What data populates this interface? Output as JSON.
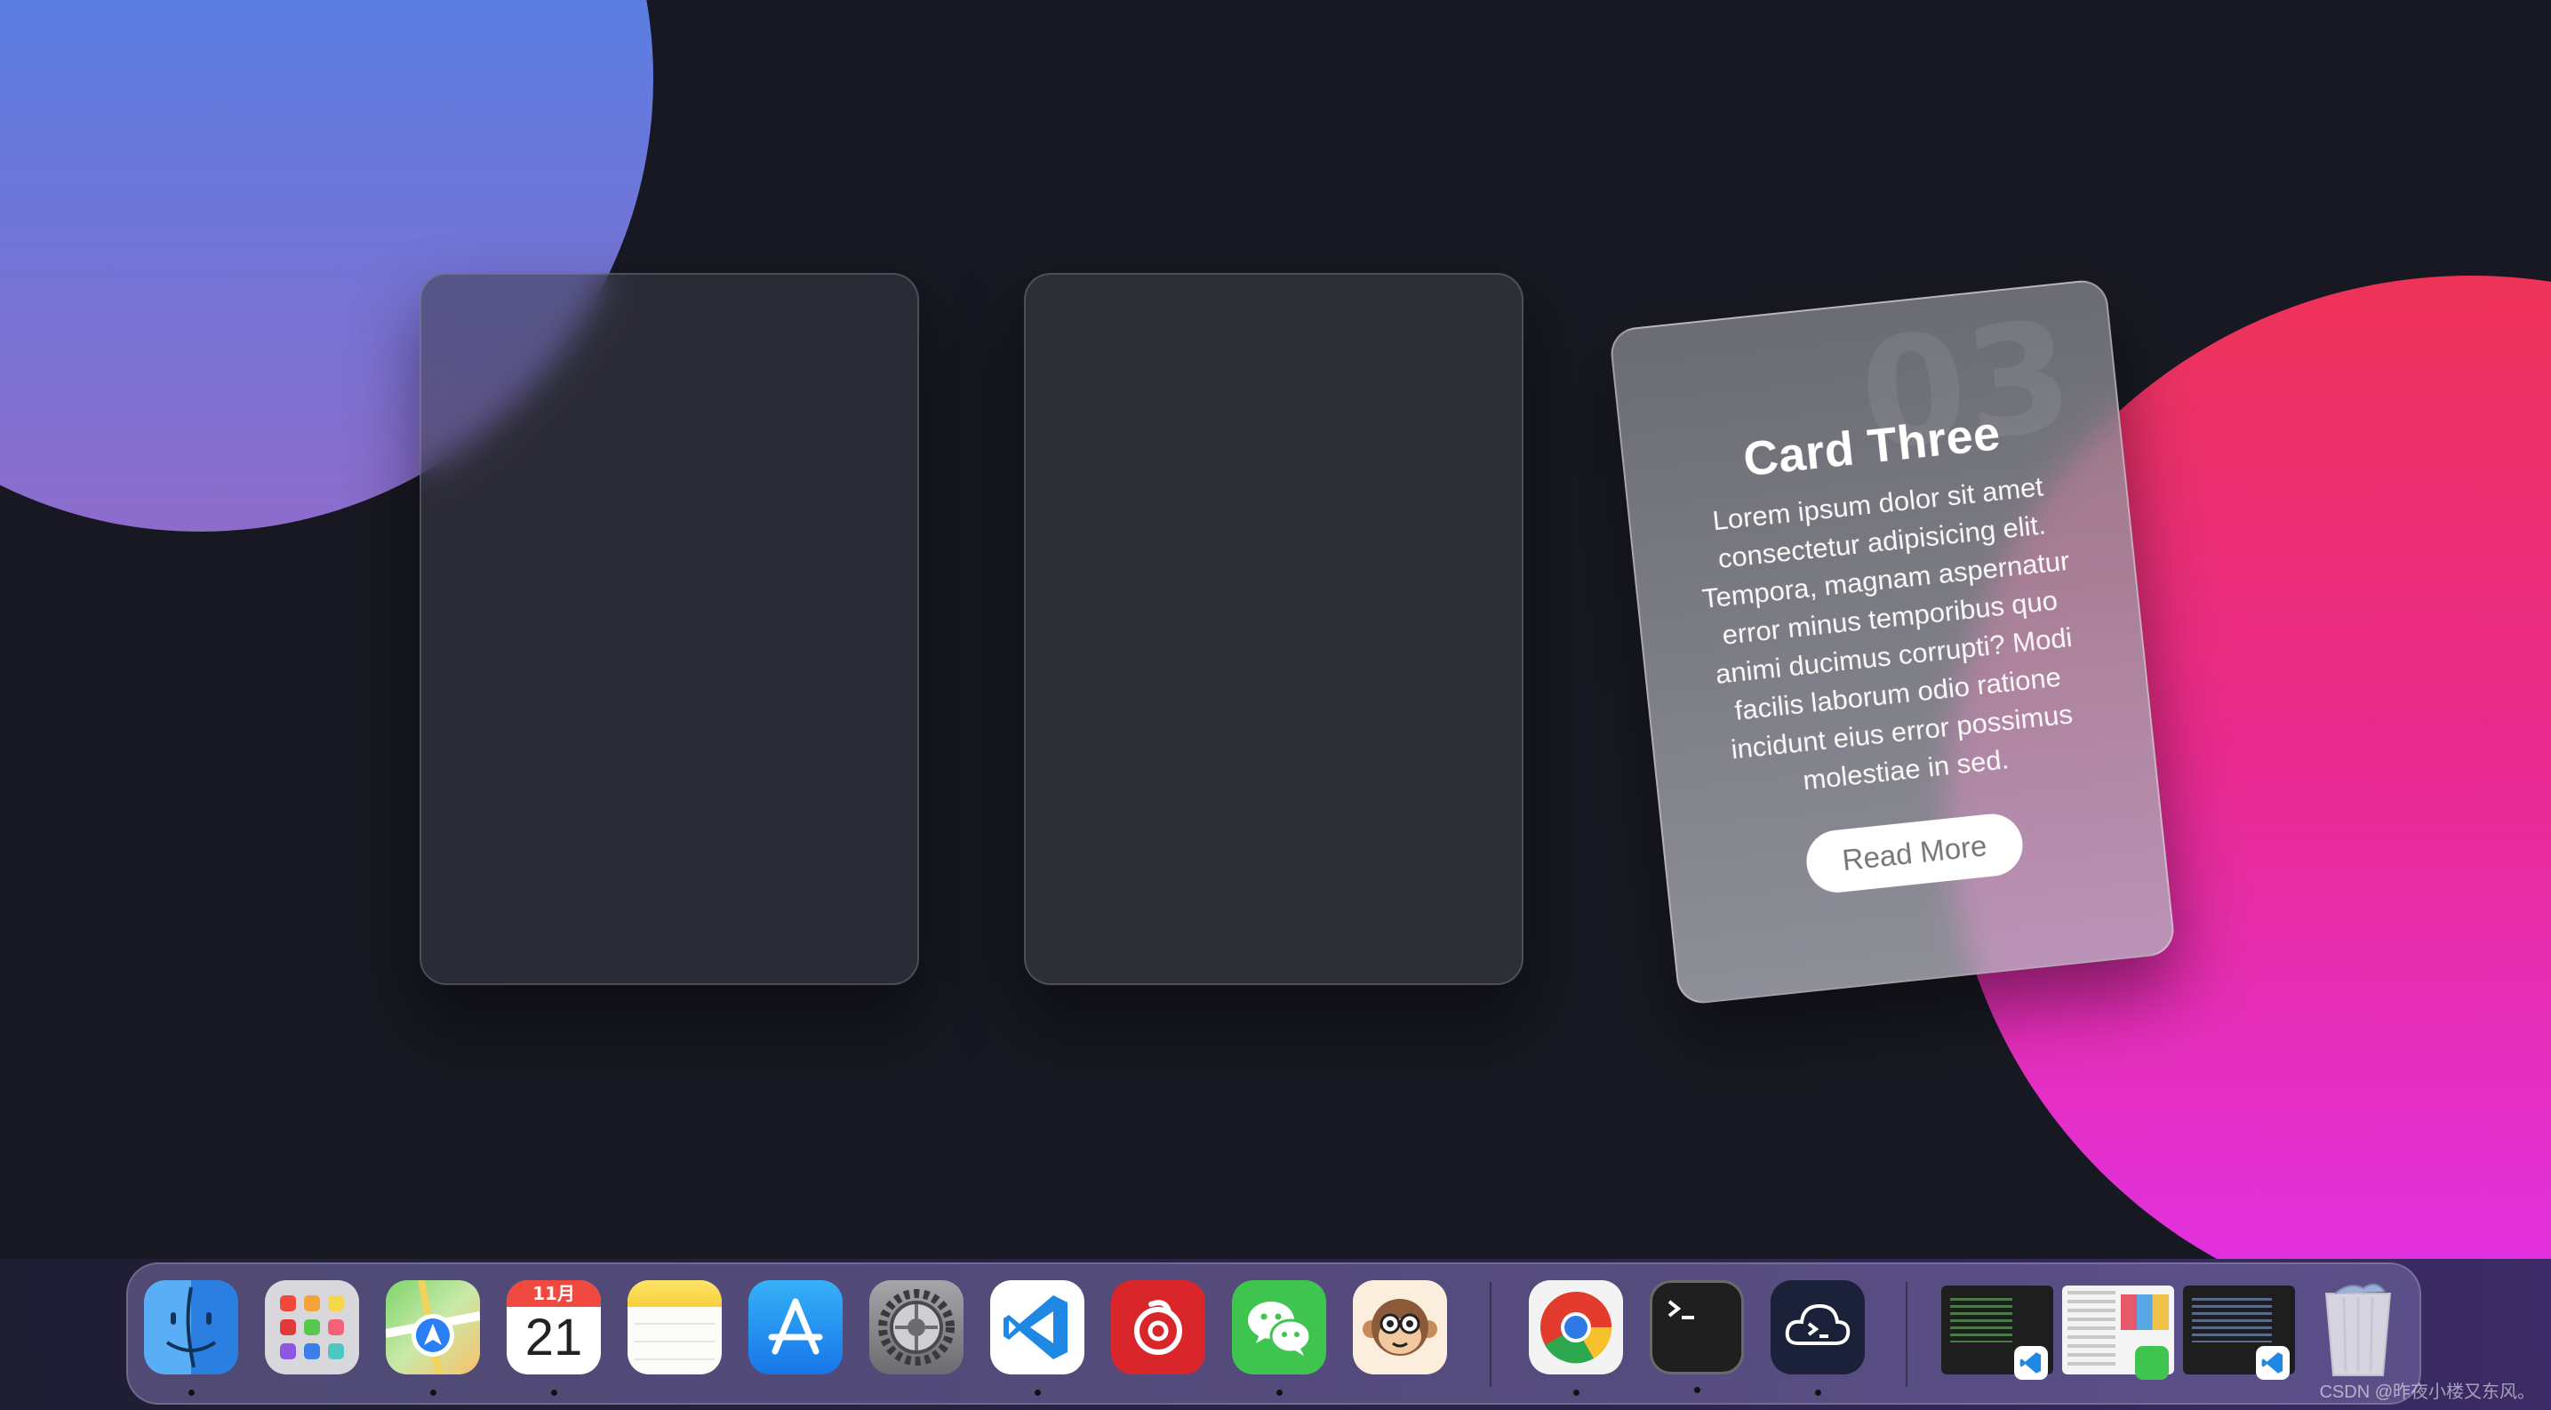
{
  "cards": [
    {
      "title": "",
      "body": ""
    },
    {
      "title": "",
      "body": ""
    },
    {
      "number": "03",
      "title": "Card Three",
      "body": "Lorem ipsum dolor sit amet consectetur adipisicing elit. Tempora, magnam aspernatur error minus temporibus quo animi ducimus corrupti? Modi facilis laborum odio ratione incidunt eius error possimus molestiae in sed.",
      "button_label": "Read More"
    }
  ],
  "dock": {
    "calendar": {
      "month": "11月",
      "day": "21"
    },
    "apps": [
      {
        "name": "finder-icon",
        "running": true
      },
      {
        "name": "launchpad-icon",
        "running": false
      },
      {
        "name": "maps-icon",
        "running": true
      },
      {
        "name": "calendar-icon",
        "running": true
      },
      {
        "name": "notes-icon",
        "running": false
      },
      {
        "name": "app-store-icon",
        "running": false
      },
      {
        "name": "system-settings-icon",
        "running": false
      },
      {
        "name": "vscode-icon",
        "running": true
      },
      {
        "name": "netease-music-icon",
        "running": false
      },
      {
        "name": "wechat-icon",
        "running": true
      },
      {
        "name": "monkey-app-icon",
        "running": false
      },
      {
        "name": "chrome-icon",
        "running": true
      },
      {
        "name": "terminal-icon",
        "running": true
      },
      {
        "name": "cloud-terminal-icon",
        "running": true
      },
      {
        "name": "trash-icon",
        "running": false
      }
    ]
  },
  "watermark": "CSDN @昨夜小楼又东风。",
  "colors": {
    "background": "#181822",
    "blob_blue": "#3c8fee",
    "blob_pink": "#ea2a8e",
    "dock": "#786eaa"
  }
}
